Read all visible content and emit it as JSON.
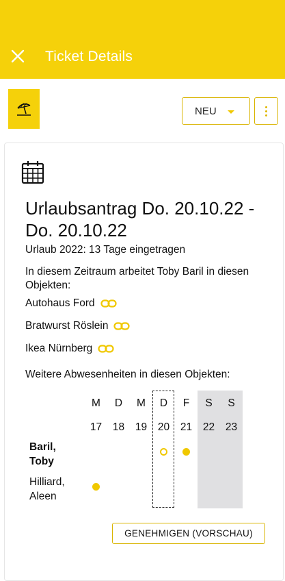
{
  "colors": {
    "accent": "#f5d10a",
    "weekend": "#e0e0e2"
  },
  "appbar": {
    "title": "Ticket Details",
    "close_icon": "close-icon"
  },
  "ticket": {
    "type_icon": "beach-umbrella-icon",
    "status": "NEU",
    "more_icon": "more-vertical-icon"
  },
  "content": {
    "calendar_icon": "calendar-icon",
    "headline": "Urlaubsantrag Do. 20.10.22 - Do. 20.10.22",
    "subline": "Urlaub 2022: 13 Tage eingetragen",
    "intro": "In diesem Zeitraum arbeitet Toby Baril in diesen Objekten:",
    "objects": [
      {
        "name": "Autohaus Ford",
        "icon": "link-icon"
      },
      {
        "name": "Bratwurst Röslein",
        "icon": "link-icon"
      },
      {
        "name": "Ikea Nürnberg",
        "icon": "link-icon"
      }
    ],
    "absences_label": "Weitere Abwesenheiten in diesen Objekten:"
  },
  "calendar": {
    "days": [
      {
        "letter": "M",
        "num": "17",
        "weekend": false,
        "highlighted": false
      },
      {
        "letter": "D",
        "num": "18",
        "weekend": false,
        "highlighted": false
      },
      {
        "letter": "M",
        "num": "19",
        "weekend": false,
        "highlighted": false
      },
      {
        "letter": "D",
        "num": "20",
        "weekend": false,
        "highlighted": true
      },
      {
        "letter": "F",
        "num": "21",
        "weekend": false,
        "highlighted": false
      },
      {
        "letter": "S",
        "num": "22",
        "weekend": true,
        "highlighted": false
      },
      {
        "letter": "S",
        "num": "23",
        "weekend": true,
        "highlighted": false
      }
    ],
    "people": [
      {
        "name_line1": "Baril,",
        "name_line2": "Toby",
        "bold": true,
        "marks": [
          {
            "day_index": 3,
            "style": "ring"
          },
          {
            "day_index": 4,
            "style": "filled"
          }
        ]
      },
      {
        "name_line1": "Hilliard,",
        "name_line2": "Aleen",
        "bold": false,
        "marks": [
          {
            "day_index": 0,
            "style": "filled"
          }
        ]
      }
    ]
  },
  "actions": {
    "approve_label": "GENEHMIGEN (VORSCHAU)"
  }
}
